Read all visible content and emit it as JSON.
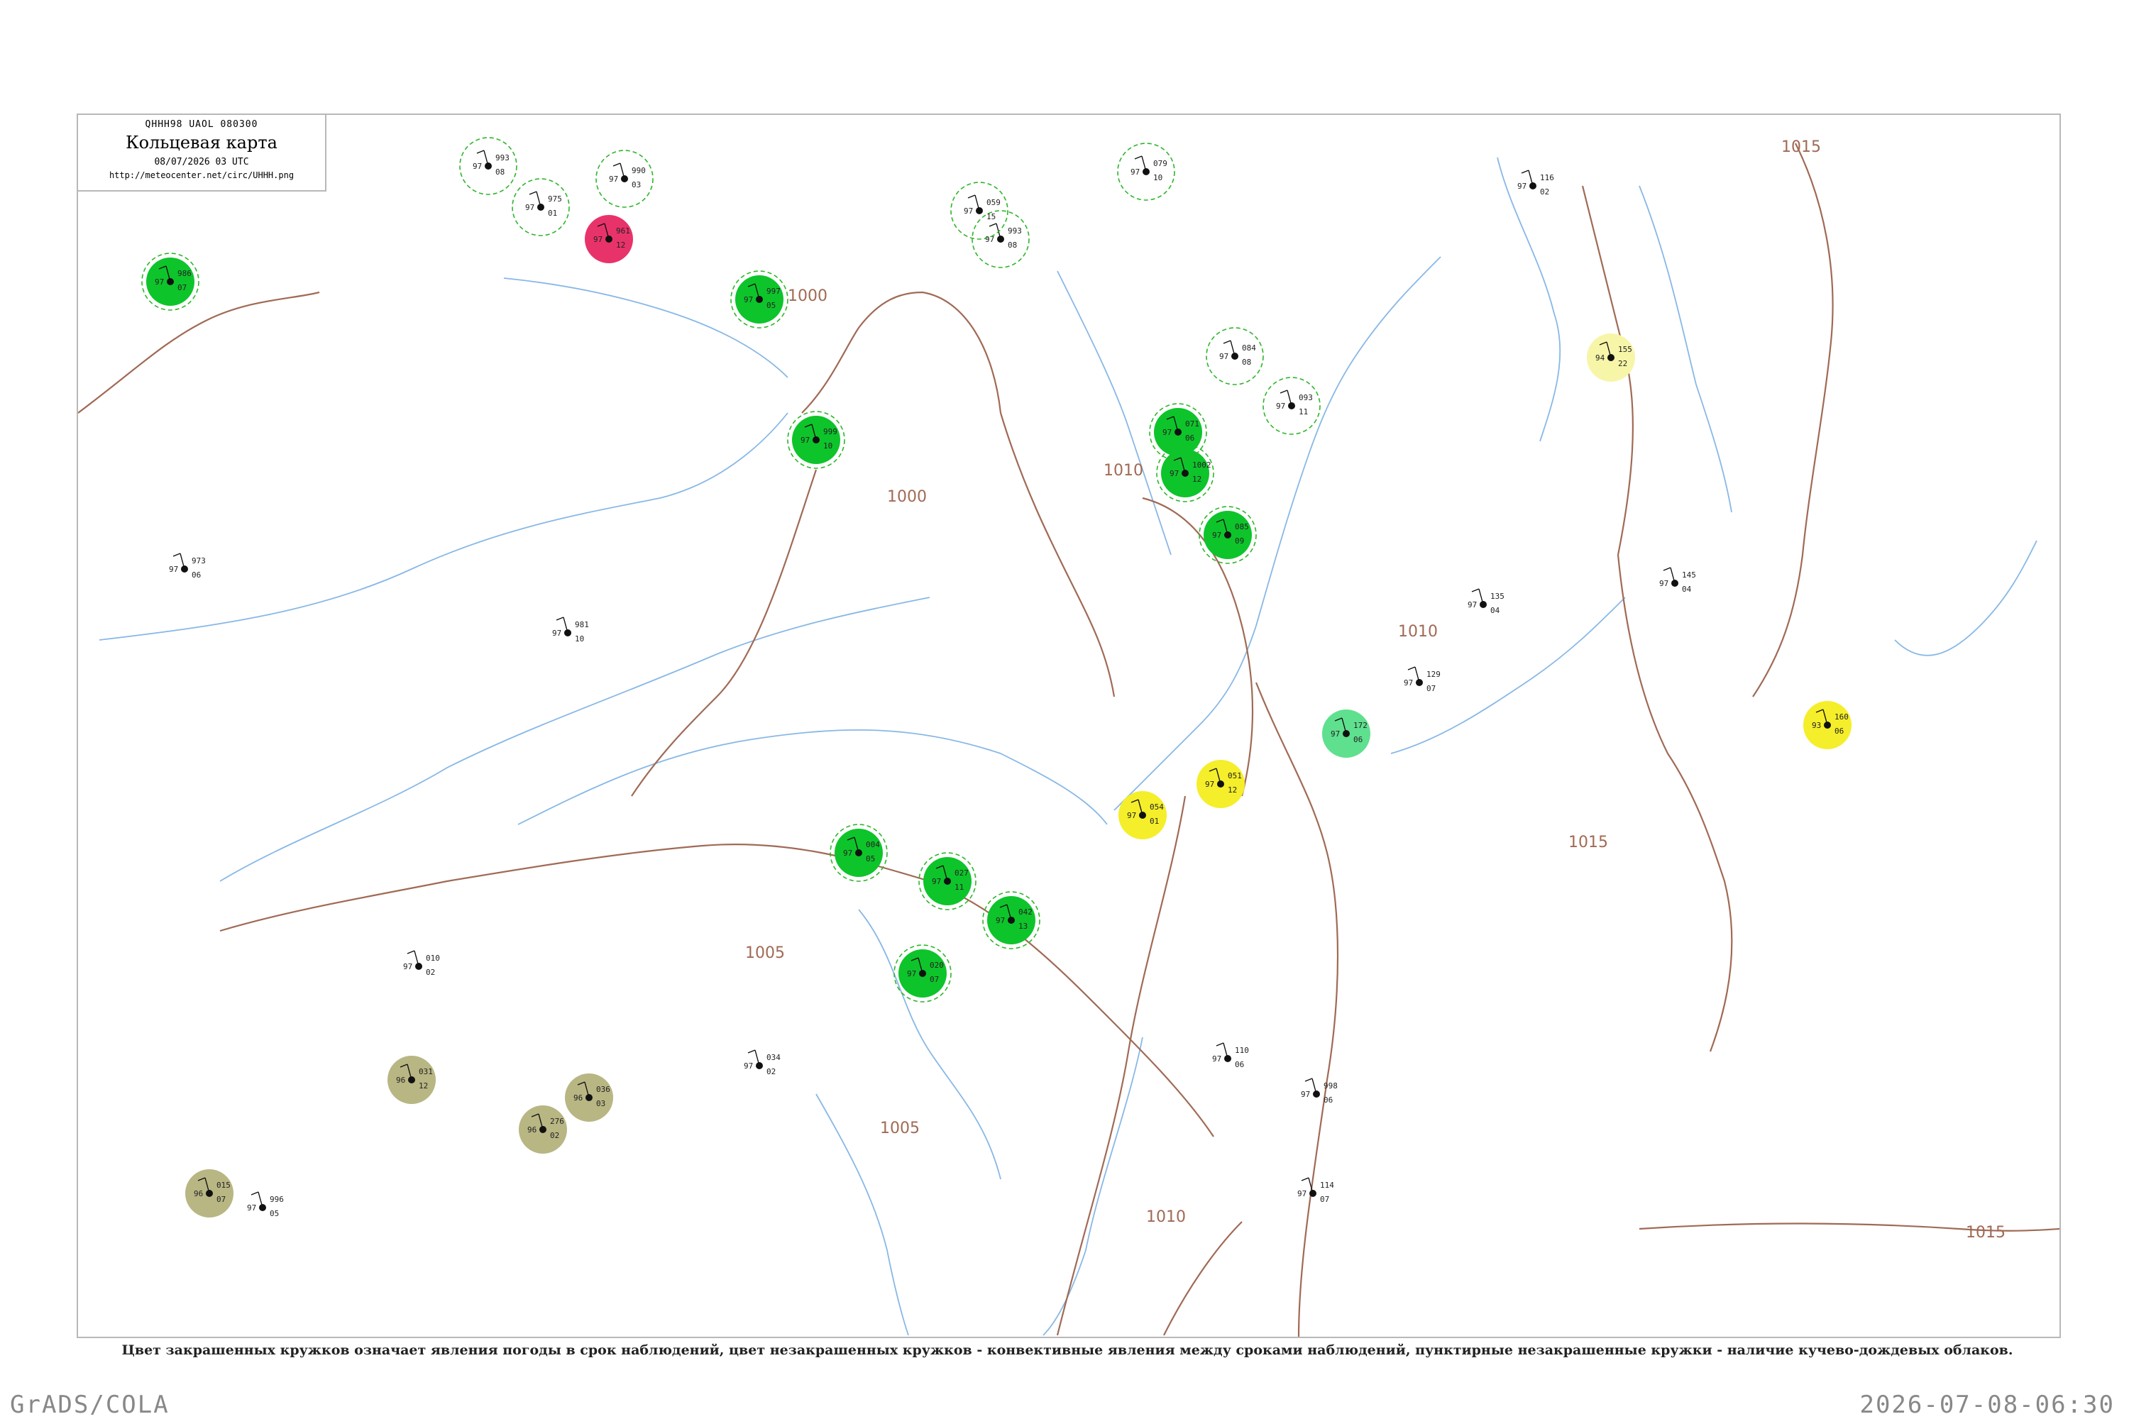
{
  "header": {
    "code": "QHHH98  UAOL  080300",
    "title": "Кольцевая карта",
    "datetime": "08/07/2026 03 UTC",
    "url": "http://meteocenter.net/circ/UHHH.png"
  },
  "caption": "Цвет закрашенных кружков означает явления погоды в срок наблюдений, цвет незакрашенных кружков - конвективные явления между сроками наблюдений, пунктирные незакрашенные кружки - наличие кучево-дождевых облаков.",
  "footer": {
    "left": "GrADS/COLA",
    "right": "2026-07-08-06:30"
  },
  "colors": {
    "rain_fill": "#0ec42b",
    "thunder_fill": "#e8336a",
    "fog_fill": "#f5ee2a",
    "haze_fill": "#b8b683",
    "light_fill": "#f7f5a8",
    "cb_ring": "#2fb52a",
    "isobar": "#a06a55",
    "river": "#88b8e6"
  },
  "isobar_labels": [
    "1000",
    "1000",
    "1005",
    "1005",
    "1010",
    "1010",
    "1010",
    "1015",
    "1015",
    "1015"
  ],
  "stations": [
    {
      "id": "s1",
      "p": "986",
      "t": "97",
      "d": "07",
      "c": "rain"
    },
    {
      "id": "s2",
      "p": "993",
      "t": "97",
      "d": "08",
      "c": "cb"
    },
    {
      "id": "s3",
      "p": "975",
      "t": "97",
      "d": "01",
      "c": "cb"
    },
    {
      "id": "s4",
      "p": "961",
      "t": "97",
      "d": "12",
      "c": "thunder"
    },
    {
      "id": "s5",
      "p": "990",
      "t": "97",
      "d": "03",
      "c": "cb"
    },
    {
      "id": "s6",
      "p": "993",
      "t": "97",
      "d": "08",
      "c": "cb"
    },
    {
      "id": "s7",
      "p": "997",
      "t": "97",
      "d": "05",
      "c": "rain"
    },
    {
      "id": "s8",
      "p": "999",
      "t": "97",
      "d": "10",
      "c": "rain"
    },
    {
      "id": "s9",
      "p": "1002",
      "t": "97",
      "d": "12",
      "c": "rain"
    },
    {
      "id": "s10",
      "p": "059",
      "t": "97",
      "d": "15",
      "c": "cb"
    },
    {
      "id": "s11",
      "p": "079",
      "t": "97",
      "d": "10",
      "c": "cb"
    },
    {
      "id": "s12",
      "p": "084",
      "t": "97",
      "d": "08",
      "c": "cb"
    },
    {
      "id": "s13",
      "p": "071",
      "t": "97",
      "d": "06",
      "c": "rain"
    },
    {
      "id": "s14",
      "p": "085",
      "t": "97",
      "d": "09",
      "c": "rain"
    },
    {
      "id": "s15",
      "p": "093",
      "t": "97",
      "d": "11",
      "c": "cb"
    },
    {
      "id": "s16",
      "p": "155",
      "t": "94",
      "d": "22",
      "c": "light"
    },
    {
      "id": "s17",
      "p": "160",
      "t": "93",
      "d": "06",
      "c": "fog"
    },
    {
      "id": "s18",
      "p": "172",
      "t": "97",
      "d": "06",
      "c": "mint"
    },
    {
      "id": "s19",
      "p": "051",
      "t": "97",
      "d": "12",
      "c": "fog"
    },
    {
      "id": "s20",
      "p": "054",
      "t": "97",
      "d": "01",
      "c": "fog"
    },
    {
      "id": "s21",
      "p": "031",
      "t": "96",
      "d": "12",
      "c": "haze"
    },
    {
      "id": "s22",
      "p": "036",
      "t": "96",
      "d": "03",
      "c": "haze"
    },
    {
      "id": "s23",
      "p": "015",
      "t": "96",
      "d": "07",
      "c": "haze"
    },
    {
      "id": "s24",
      "p": "276",
      "t": "96",
      "d": "02",
      "c": "haze"
    },
    {
      "id": "s25",
      "p": "004",
      "t": "97",
      "d": "05",
      "c": "rain"
    },
    {
      "id": "s26",
      "p": "027",
      "t": "97",
      "d": "11",
      "c": "rain"
    },
    {
      "id": "s27",
      "p": "042",
      "t": "97",
      "d": "13",
      "c": "rain"
    },
    {
      "id": "s28",
      "p": "020",
      "t": "97",
      "d": "07",
      "c": "rain"
    },
    {
      "id": "s29",
      "p": "034",
      "t": "97",
      "d": "02",
      "c": "none"
    },
    {
      "id": "s30",
      "p": "010",
      "t": "97",
      "d": "02",
      "c": "none"
    },
    {
      "id": "s31",
      "p": "129",
      "t": "97",
      "d": "07",
      "c": "none"
    },
    {
      "id": "s32",
      "p": "145",
      "t": "97",
      "d": "04",
      "c": "none"
    },
    {
      "id": "s33",
      "p": "116",
      "t": "97",
      "d": "02",
      "c": "none"
    },
    {
      "id": "s34",
      "p": "135",
      "t": "97",
      "d": "04",
      "c": "none"
    },
    {
      "id": "s35",
      "p": "981",
      "t": "97",
      "d": "10",
      "c": "none"
    },
    {
      "id": "s36",
      "p": "973",
      "t": "97",
      "d": "06",
      "c": "none"
    },
    {
      "id": "s37",
      "p": "996",
      "t": "97",
      "d": "05",
      "c": "none"
    },
    {
      "id": "s38",
      "p": "998",
      "t": "97",
      "d": "06",
      "c": "none"
    },
    {
      "id": "s39",
      "p": "110",
      "t": "97",
      "d": "06",
      "c": "none"
    },
    {
      "id": "s40",
      "p": "114",
      "t": "97",
      "d": "07",
      "c": "none"
    }
  ]
}
